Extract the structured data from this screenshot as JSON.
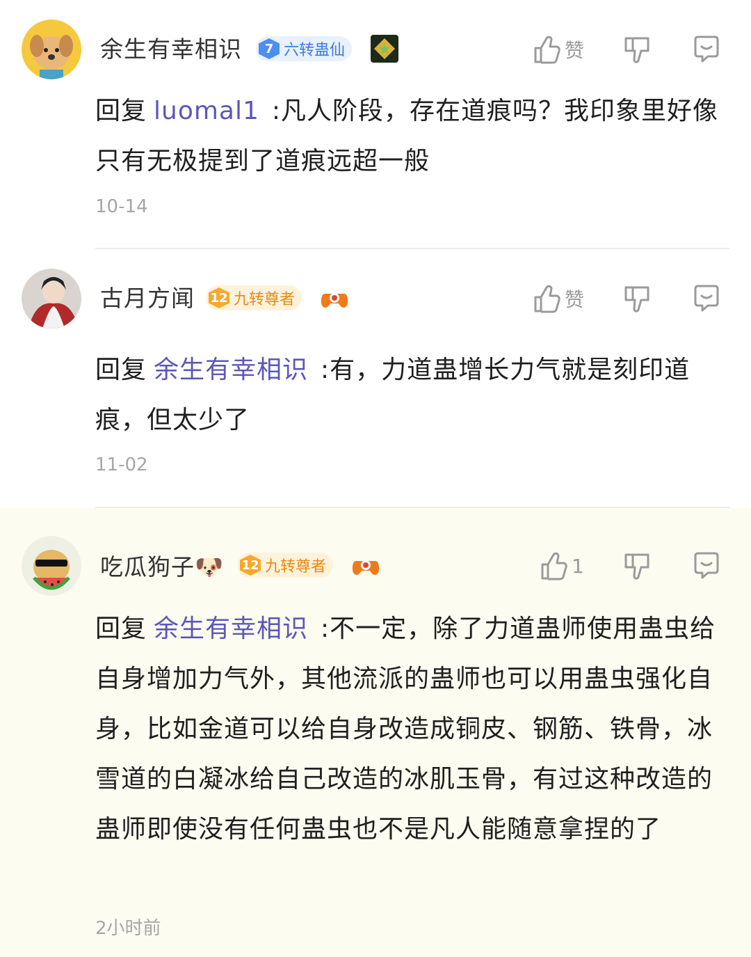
{
  "comments": [
    {
      "username": "余生有幸相识",
      "level": "7",
      "rank": "六转蛊仙",
      "like_label": "赞",
      "reply_prefix": "回复",
      "mention": "luomal1",
      "text": ":凡人阶段，存在道痕吗？我印象里好像只有无极提到了道痕远超一般",
      "time": "10-14"
    },
    {
      "username": "古月方闻",
      "level": "12",
      "rank": "九转尊者",
      "like_label": "赞",
      "reply_prefix": "回复",
      "mention": "余生有幸相识",
      "text": ":有，力道蛊增长力气就是刻印道痕，但太少了",
      "time": "11-02"
    },
    {
      "username": "吃瓜狗子🐶",
      "level": "12",
      "rank": "九转尊者",
      "like_label": "1",
      "reply_prefix": "回复",
      "mention": "余生有幸相识",
      "text": ":不一定，除了力道蛊师使用蛊虫给自身增加力气外，其他流派的蛊师也可以用蛊虫强化自身，比如金道可以给自身改造成铜皮、钢筋、铁骨，冰雪道的白凝冰给自己改造的冰肌玉骨，有过这种改造的蛊师即使没有任何蛊虫也不是凡人能随意拿捏的了",
      "time": "2小时前"
    }
  ],
  "colors": {
    "mention": "#5b57b8",
    "highlight_bg": "#fdfcf1",
    "badge_blue": "#4c8ff0",
    "badge_gold": "#f5a92b"
  }
}
